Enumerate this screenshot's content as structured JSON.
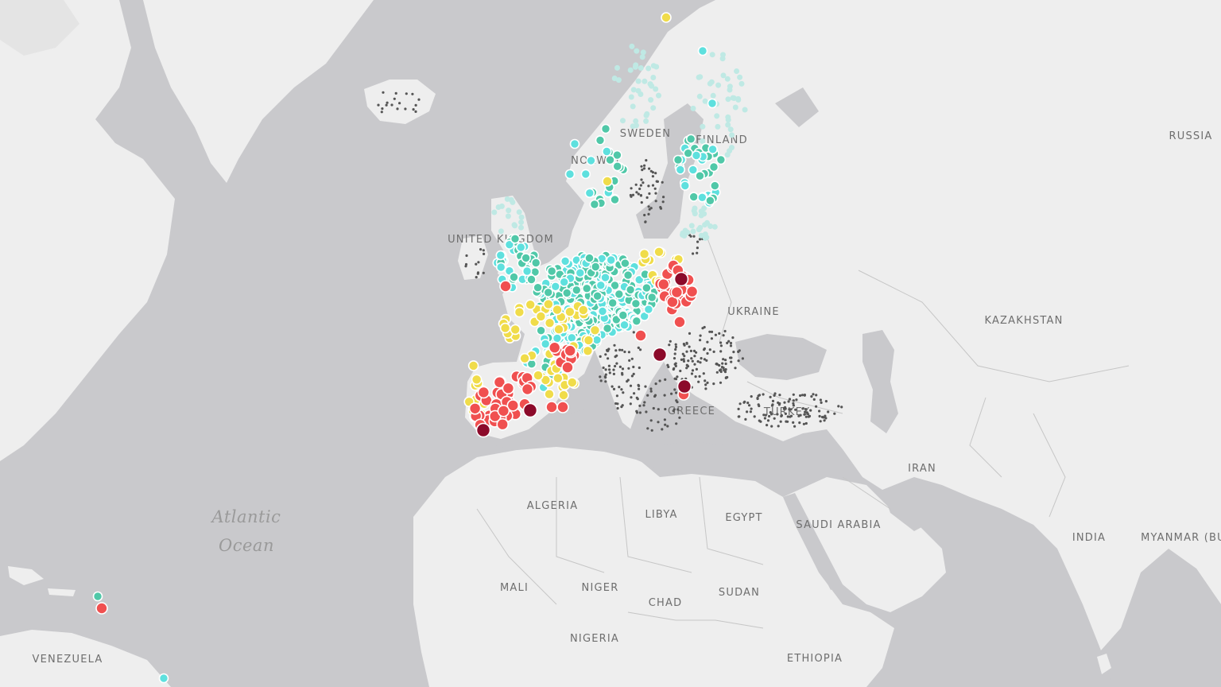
{
  "map": {
    "colors": {
      "water": "#c9c9cc",
      "land": "#eeeeee",
      "border": "#c6c6c6",
      "excellent": "#50c8a8",
      "good": "#5ee0de",
      "moderate": "#f0dc4a",
      "poor": "#f05050",
      "very_poor": "#8c0a2a",
      "no_data": "#555555"
    },
    "country_labels": [
      {
        "key": "sweden",
        "text": "SWEDEN"
      },
      {
        "key": "finland",
        "text": "FINLAND"
      },
      {
        "key": "norway",
        "text": "NORWAY"
      },
      {
        "key": "russia",
        "text": "RUSSIA"
      },
      {
        "key": "united-kingdom",
        "text": "UNITED KINGDOM"
      },
      {
        "key": "ukraine",
        "text": "UKRAINE"
      },
      {
        "key": "kazakhstan",
        "text": "KAZAKHSTAN"
      },
      {
        "key": "greece",
        "text": "GREECE"
      },
      {
        "key": "turkey",
        "text": "TURKEY"
      },
      {
        "key": "iran",
        "text": "IRAN"
      },
      {
        "key": "algeria",
        "text": "ALGERIA"
      },
      {
        "key": "libya",
        "text": "LIBYA"
      },
      {
        "key": "egypt",
        "text": "EGYPT"
      },
      {
        "key": "saudi-arabia",
        "text": "SAUDI ARABIA"
      },
      {
        "key": "india",
        "text": "INDIA"
      },
      {
        "key": "myanmar",
        "text": "MYANMAR (BURMA)"
      },
      {
        "key": "mali",
        "text": "MALI"
      },
      {
        "key": "niger",
        "text": "NIGER"
      },
      {
        "key": "chad",
        "text": "CHAD"
      },
      {
        "key": "sudan",
        "text": "SUDAN"
      },
      {
        "key": "nigeria",
        "text": "NIGERIA"
      },
      {
        "key": "ethiopia",
        "text": "ETHIOPIA"
      },
      {
        "key": "venezuela",
        "text": "VENEZUELA"
      }
    ],
    "ocean_label": {
      "line1": "Atlantic",
      "line2": "Ocean"
    }
  }
}
